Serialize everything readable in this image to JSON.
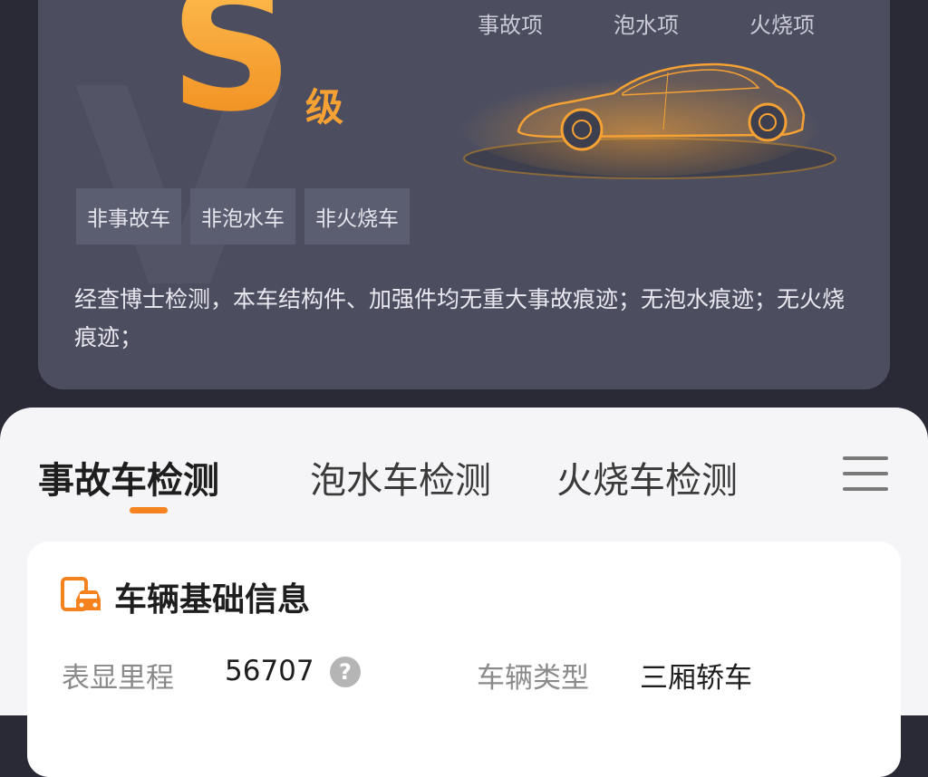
{
  "summary": {
    "grade_letter": "S",
    "grade_suffix": "级",
    "columns": [
      "事故项",
      "泡水项",
      "火烧项"
    ],
    "tags": [
      "非事故车",
      "非泡水车",
      "非火烧车"
    ],
    "description": "经查博士检测，本车结构件、加强件均无重大事故痕迹；无泡水痕迹；无火烧痕迹；",
    "accent_color": "#f6a133"
  },
  "tabs": [
    {
      "label": "事故车检测",
      "active": true
    },
    {
      "label": "泡水车检测",
      "active": false
    },
    {
      "label": "火烧车检测",
      "active": false
    }
  ],
  "menu_icon": "hamburger-menu-icon",
  "vehicle_info": {
    "title": "车辆基础信息",
    "icon": "vehicle-document-icon",
    "fields": [
      {
        "label": "表显里程",
        "value": "56707",
        "help_icon": "question-circle-icon",
        "help_glyph": "?"
      },
      {
        "label": "车辆类型",
        "value": "三厢轿车"
      }
    ]
  }
}
